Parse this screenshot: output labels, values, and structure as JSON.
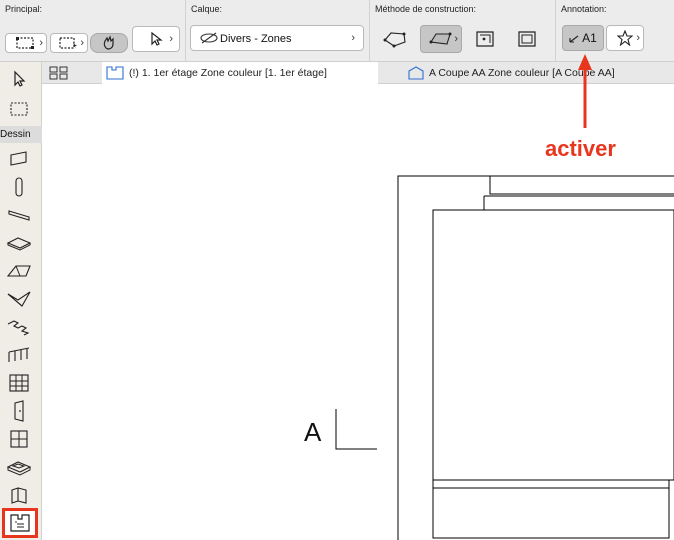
{
  "infobox": {
    "principal_label": "Principal:",
    "calque_label": "Calque:",
    "calque_value": "Divers - Zones",
    "methode_label": "Méthode de construction:",
    "annotation_label": "Annotation:",
    "annotation_value": "A1"
  },
  "toolbox": {
    "group_label": "Dessin"
  },
  "tabs": [
    {
      "label": "(!) 1. 1er étage Zone couleur [1. 1er étage]"
    },
    {
      "label": "A Coupe AA Zone couleur [A Coupe AA]"
    }
  ],
  "drawing": {
    "section_marker": "A"
  },
  "callout": {
    "text": "activer",
    "color": "#e8361e"
  }
}
